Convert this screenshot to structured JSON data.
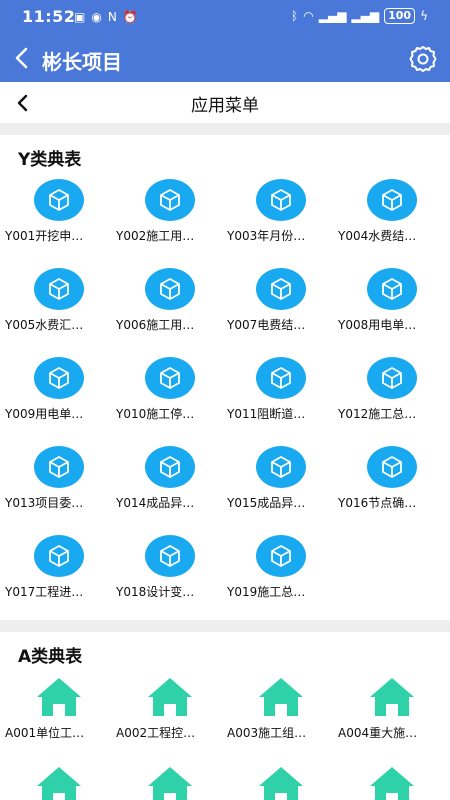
{
  "status": {
    "time": "11:52",
    "battery": "100"
  },
  "header": {
    "title": "彬长项目"
  },
  "subheader": {
    "title": "应用菜单"
  },
  "sections": [
    {
      "title": "Y类典表",
      "icon": "cube-icon",
      "items": [
        "Y001开挖申…",
        "Y002施工用…",
        "Y003年月份…",
        "Y004水费结…",
        "Y005水费汇…",
        "Y006施工用…",
        "Y007电费结…",
        "Y008用电单…",
        "Y009用电单…",
        "Y010施工停…",
        "Y011阻断道…",
        "Y012施工总…",
        "Y013项目委…",
        "Y014成品异…",
        "Y015成品异…",
        "Y016节点确…",
        "Y017工程进…",
        "Y018设计变…",
        "Y019施工总…"
      ]
    },
    {
      "title": "A类典表",
      "icon": "house-icon",
      "items": [
        "A001单位工…",
        "A002工程控…",
        "A003施工组…",
        "A004重大施…",
        "",
        "",
        "",
        ""
      ]
    }
  ],
  "colors": {
    "header": "#4a78d9",
    "cube": "#19a9f0",
    "house": "#2fd1a8"
  }
}
